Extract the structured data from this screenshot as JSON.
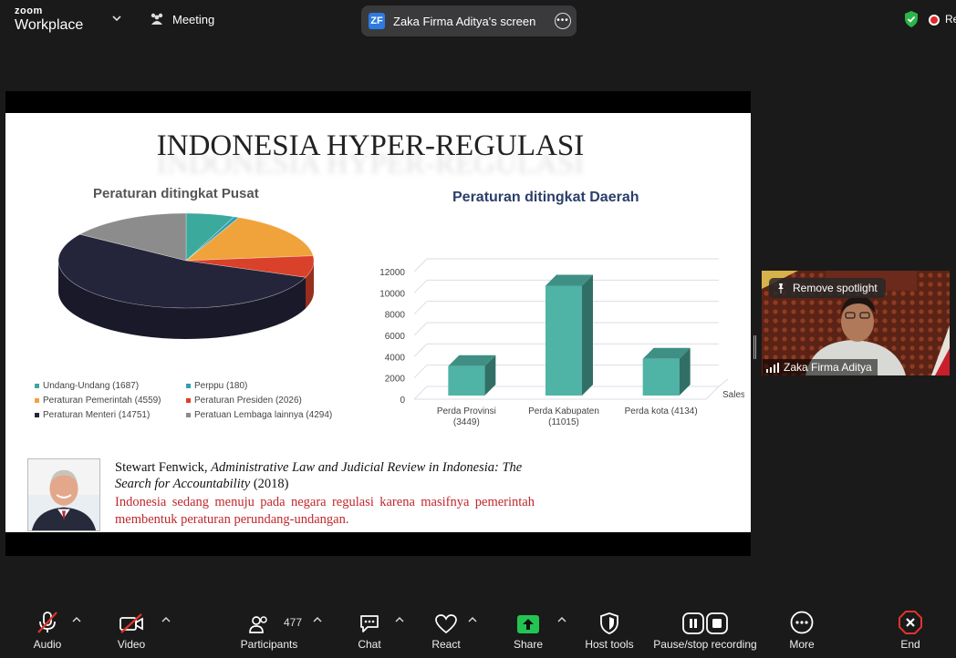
{
  "app": {
    "brand_small": "zoom",
    "brand_big": "Workplace"
  },
  "topbar": {
    "meeting_label": "Meeting",
    "share_badge": "ZF",
    "share_title": "Zaka Firma Aditya's screen",
    "rec_label": "Re"
  },
  "slide": {
    "title": "INDONESIA HYPER-REGULASI",
    "citation_author": "Stewart Fenwick,",
    "citation_work": "Administrative Law and Judicial Review in Indonesia: The Search for Accountability",
    "citation_year": "(2018)",
    "quote": "Indonesia sedang menuju pada negara regulasi karena masifnya pemerintah membentuk peraturan perundang-undangan."
  },
  "chart_data": [
    {
      "type": "pie",
      "title": "Peraturan ditingkat Pusat",
      "categories": [
        "Undang-Undang (1687)",
        "Perppu (180)",
        "Peraturan Pemerintah (4559)",
        "Peraturan Presiden (2026)",
        "Peraturan Menteri (14751)",
        "Peratuan Lembaga lainnya (4294)"
      ],
      "values": [
        1687,
        180,
        4559,
        2026,
        14751,
        4294
      ],
      "colors": [
        "#3ba99c",
        "#2f9fb5",
        "#f0a33a",
        "#d9412a",
        "#24243a",
        "#8c8c8c"
      ],
      "legend": "bottom"
    },
    {
      "type": "bar",
      "title": "Peraturan ditingkat Daerah",
      "categories": [
        "Perda Provinsi (3449)",
        "Perda Kabupaten (11015)",
        "Perda kota (4134)"
      ],
      "category_lines": [
        [
          "Perda Provinsi",
          "(3449)"
        ],
        [
          "Perda Kabupaten",
          "(11015)"
        ],
        [
          "Perda kota (4134)"
        ]
      ],
      "series": [
        {
          "name": "Sales",
          "values": [
            3449,
            11015,
            4134
          ]
        }
      ],
      "ylim": [
        0,
        12000
      ],
      "yticks": [
        0,
        2000,
        4000,
        6000,
        8000,
        10000,
        12000
      ],
      "color": "#4fb3a5",
      "grid": true
    }
  ],
  "participant": {
    "name": "Zaka Firma Aditya",
    "spotlight_label": "Remove spotlight"
  },
  "toolbar": {
    "audio": "Audio",
    "video": "Video",
    "participants": "Participants",
    "participants_count": "477",
    "chat": "Chat",
    "react": "React",
    "share": "Share",
    "host_tools": "Host tools",
    "recording": "Pause/stop recording",
    "more": "More",
    "end": "End"
  }
}
